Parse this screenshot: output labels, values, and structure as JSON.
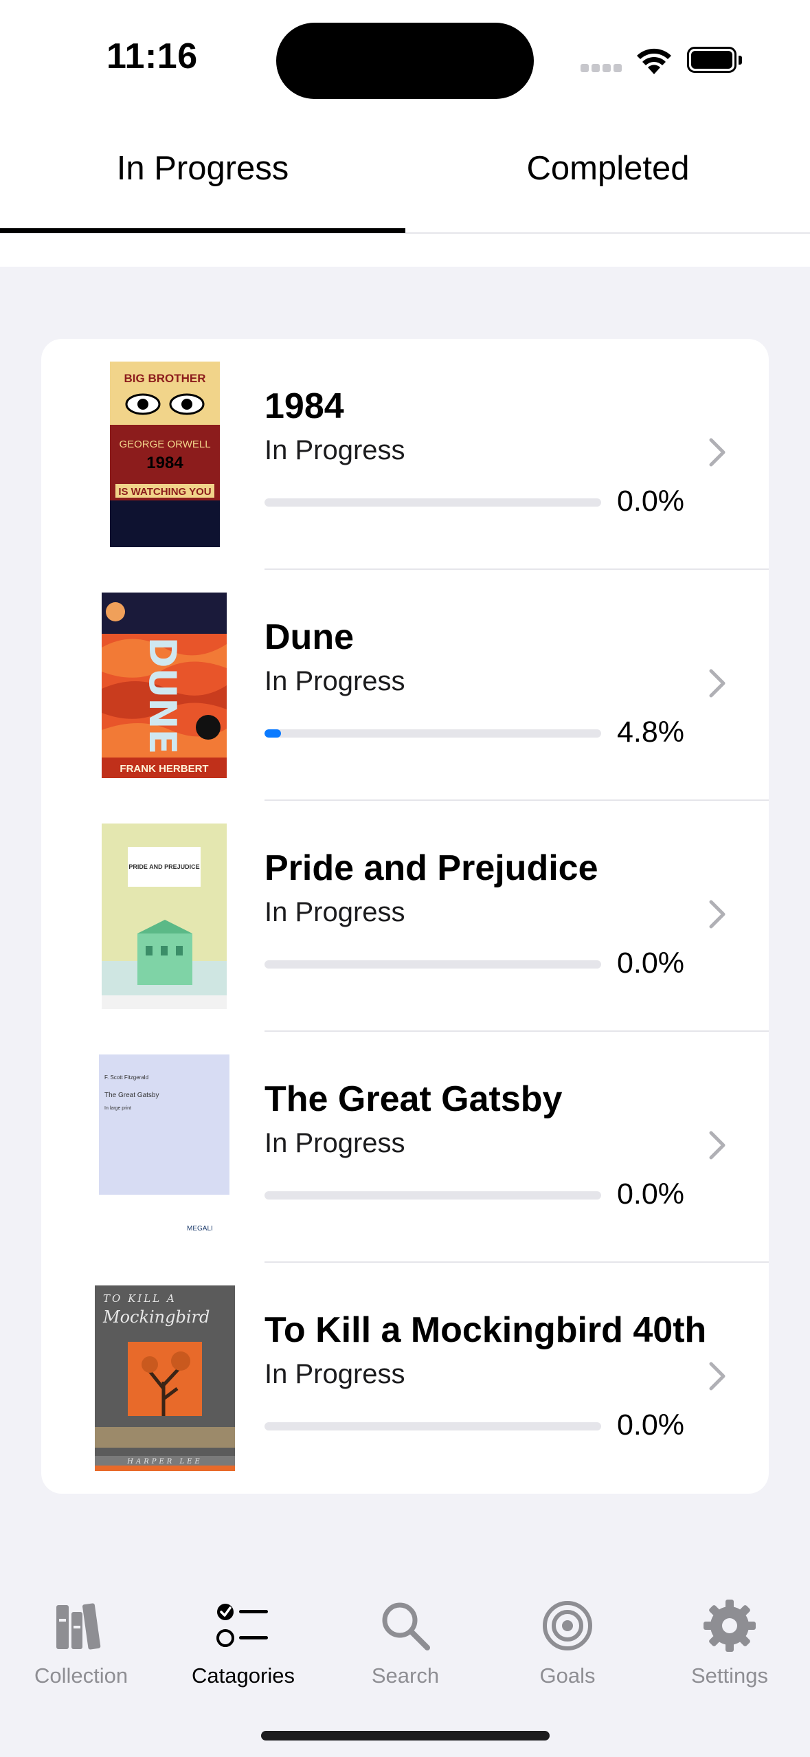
{
  "status_bar": {
    "time": "11:16"
  },
  "segments": [
    {
      "label": "In Progress",
      "selected": true
    },
    {
      "label": "Completed",
      "selected": false
    }
  ],
  "books": [
    {
      "title": "1984",
      "status": "In Progress",
      "progress": 0.0,
      "progress_label": "0.0%",
      "cover": "1984-cover"
    },
    {
      "title": "Dune",
      "status": "In Progress",
      "progress": 0.048,
      "progress_label": "4.8%",
      "cover": "dune-cover"
    },
    {
      "title": "Pride and Prejudice",
      "status": "In Progress",
      "progress": 0.0,
      "progress_label": "0.0%",
      "cover": "pride-and-prejudice-cover"
    },
    {
      "title": "The Great Gatsby",
      "status": "In Progress",
      "progress": 0.0,
      "progress_label": "0.0%",
      "cover": "great-gatsby-cover"
    },
    {
      "title": "To Kill a Mockingbird 40th",
      "status": "In Progress",
      "progress": 0.0,
      "progress_label": "0.0%",
      "cover": "mockingbird-cover"
    }
  ],
  "covers": {
    "c1984": {
      "l1": "BIG BROTHER",
      "l2": "GEORGE ORWELL",
      "l3": "1984",
      "l4": "IS WATCHING YOU"
    },
    "dune": {
      "author": "FRANK HERBERT"
    },
    "pride": {
      "title": "PRIDE AND PREJUDICE"
    },
    "gatsby": {
      "l1": "F. Scott Fitzgerald",
      "l2": "The Great Gatsby",
      "l3": "In large print",
      "brand": "MEGALI"
    },
    "mockingbird": {
      "l1": "TO KILL A",
      "l2": "Mockingbird",
      "author": "HARPER LEE"
    }
  },
  "tabbar": [
    {
      "label": "Collection",
      "icon": "books-icon",
      "active": false
    },
    {
      "label": "Catagories",
      "icon": "checklist-icon",
      "active": true
    },
    {
      "label": "Search",
      "icon": "search-icon",
      "active": false
    },
    {
      "label": "Goals",
      "icon": "target-icon",
      "active": false
    },
    {
      "label": "Settings",
      "icon": "gear-icon",
      "active": false
    }
  ],
  "colors": {
    "accent": "#0a7aff",
    "inactive": "#8e8e93",
    "background": "#f2f2f7"
  }
}
